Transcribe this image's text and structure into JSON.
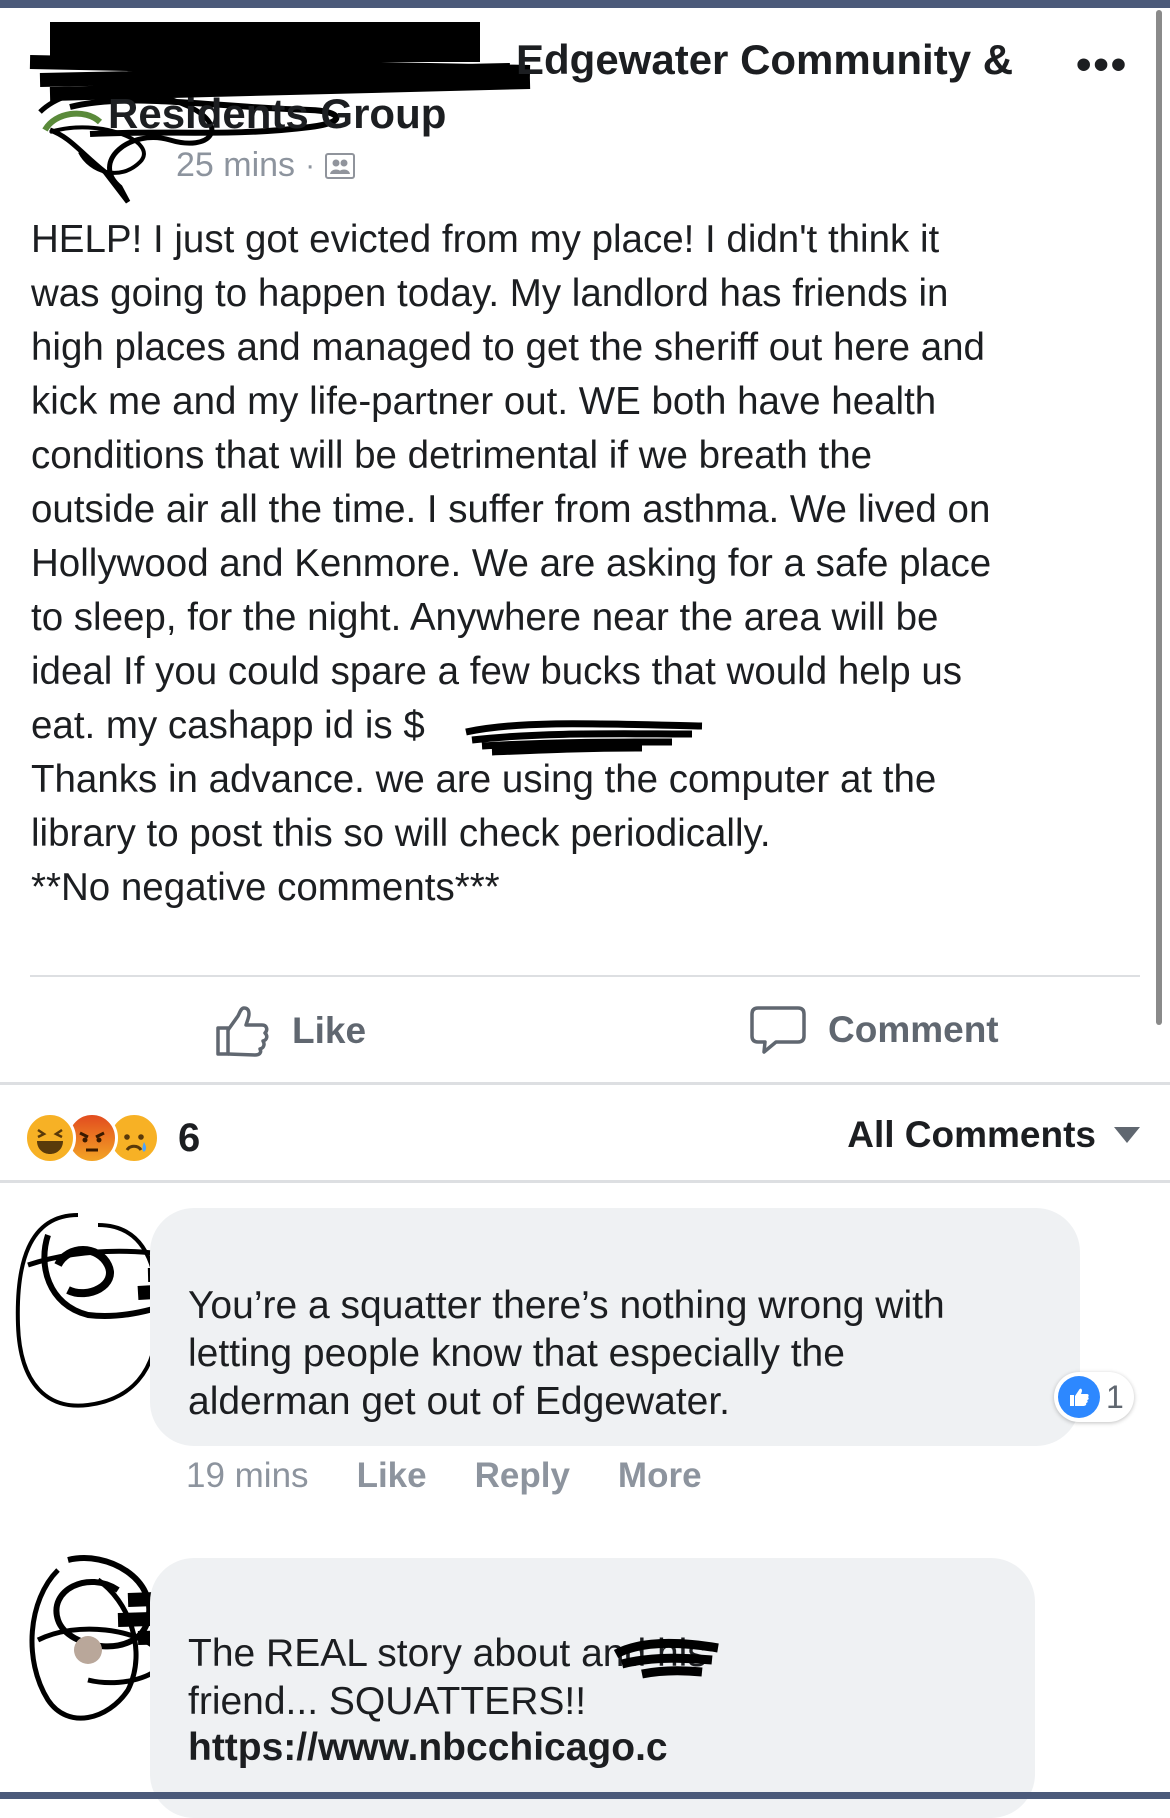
{
  "post": {
    "group_name_line1": "Edgewater Community &",
    "group_name_line2": "Residents Group",
    "time": "25 mins",
    "separator": "·",
    "body": "HELP! I just got evicted from my place! I didn't think it\nwas going to happen today. My landlord has friends in\nhigh places and managed to get the sheriff out here and\nkick me and my life-partner out. WE both have health\nconditions that will be detrimental if we breath the\noutside air all the time. I suffer from asthma. We lived on\nHollywood and Kenmore. We are asking for a safe place\nto sleep, for the night. Anywhere near the area will be\nideal If you could spare a few bucks that would help us\neat. my cashapp id is $\nThanks in advance. we are using the computer at the\nlibrary to post this so will check periodically.\n**No negative comments***"
  },
  "actions": {
    "like": "Like",
    "comment": "Comment"
  },
  "reactions": {
    "count": "6",
    "icons": [
      "haha-icon",
      "angry-icon",
      "sad-icon"
    ],
    "colors": {
      "face": "#f7b125",
      "angry": "#e9710f",
      "blue": "#2d88ff"
    }
  },
  "sort": {
    "label": "All Comments"
  },
  "comments": [
    {
      "text": "You’re a squatter there’s nothing wrong with\nletting people know that especially the\nalderman get out of Edgewater.",
      "likes": "1",
      "time": "19 mins",
      "like": "Like",
      "reply": "Reply",
      "more": "More"
    },
    {
      "text": "The REAL story about        and his\nfriend... SQUATTERS!!",
      "link": "https://www.nbcchicago.c"
    }
  ]
}
